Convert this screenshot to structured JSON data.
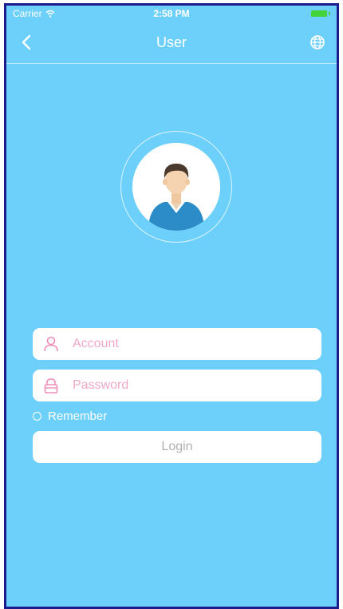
{
  "status_bar": {
    "carrier": "Carrier",
    "time": "2:58 PM",
    "battery_color": "#44d33a"
  },
  "nav": {
    "title": "User",
    "back_icon": "chevron-left-icon",
    "language_icon": "globe-icon"
  },
  "avatar": {
    "icon": "user-avatar"
  },
  "form": {
    "account_placeholder": "Account",
    "account_icon": "user-outline-icon",
    "password_placeholder": "Password",
    "password_icon": "lock-icon",
    "remember_label": "Remember",
    "remember_checked": false,
    "login_label": "Login"
  },
  "theme": {
    "background": "#6dd0fb",
    "field_icon_color": "#f08cb8",
    "placeholder_color": "#f0a8c8",
    "login_text_color": "#b0b0b0"
  }
}
